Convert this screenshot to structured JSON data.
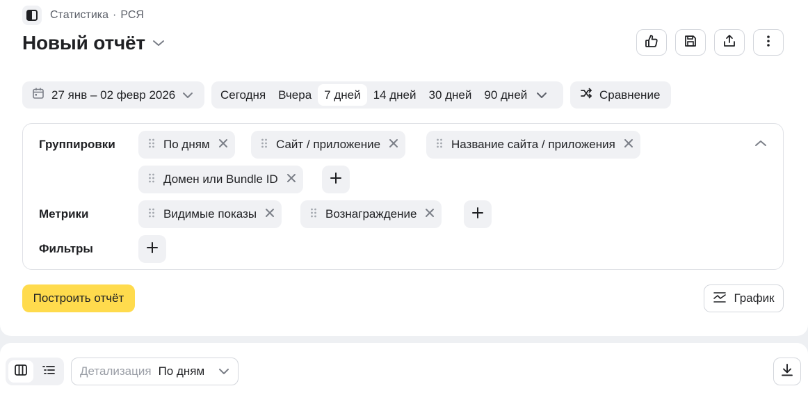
{
  "breadcrumb": {
    "section": "Статистика",
    "separator": "·",
    "subsection": "РСЯ"
  },
  "title": "Новый отчёт",
  "header_actions": [
    "like-icon",
    "save-icon",
    "share-icon",
    "more-icon"
  ],
  "date_range": {
    "label": "27 янв – 02 февр 2026"
  },
  "periods": [
    {
      "label": "Сегодня",
      "active": false
    },
    {
      "label": "Вчера",
      "active": false
    },
    {
      "label": "7 дней",
      "active": true
    },
    {
      "label": "14 дней",
      "active": false
    },
    {
      "label": "30 дней",
      "active": false
    },
    {
      "label": "90 дней",
      "active": false
    }
  ],
  "compare": {
    "label": "Сравнение"
  },
  "config": {
    "groupings_label": "Группировки",
    "groupings": [
      "По дням",
      "Сайт / приложение",
      "Название сайта / приложения",
      "Домен или Bundle ID"
    ],
    "metrics_label": "Метрики",
    "metrics": [
      "Видимые показы",
      "Вознаграждение"
    ],
    "filters_label": "Фильтры"
  },
  "build_button": "Построить отчёт",
  "chart_button": "График",
  "detail": {
    "label": "Детализация",
    "value": "По дням"
  },
  "colors": {
    "accent": "#ffdb4d",
    "chip_bg": "#f0f1f4",
    "text": "#1f2023",
    "muted": "#5b5f68"
  }
}
